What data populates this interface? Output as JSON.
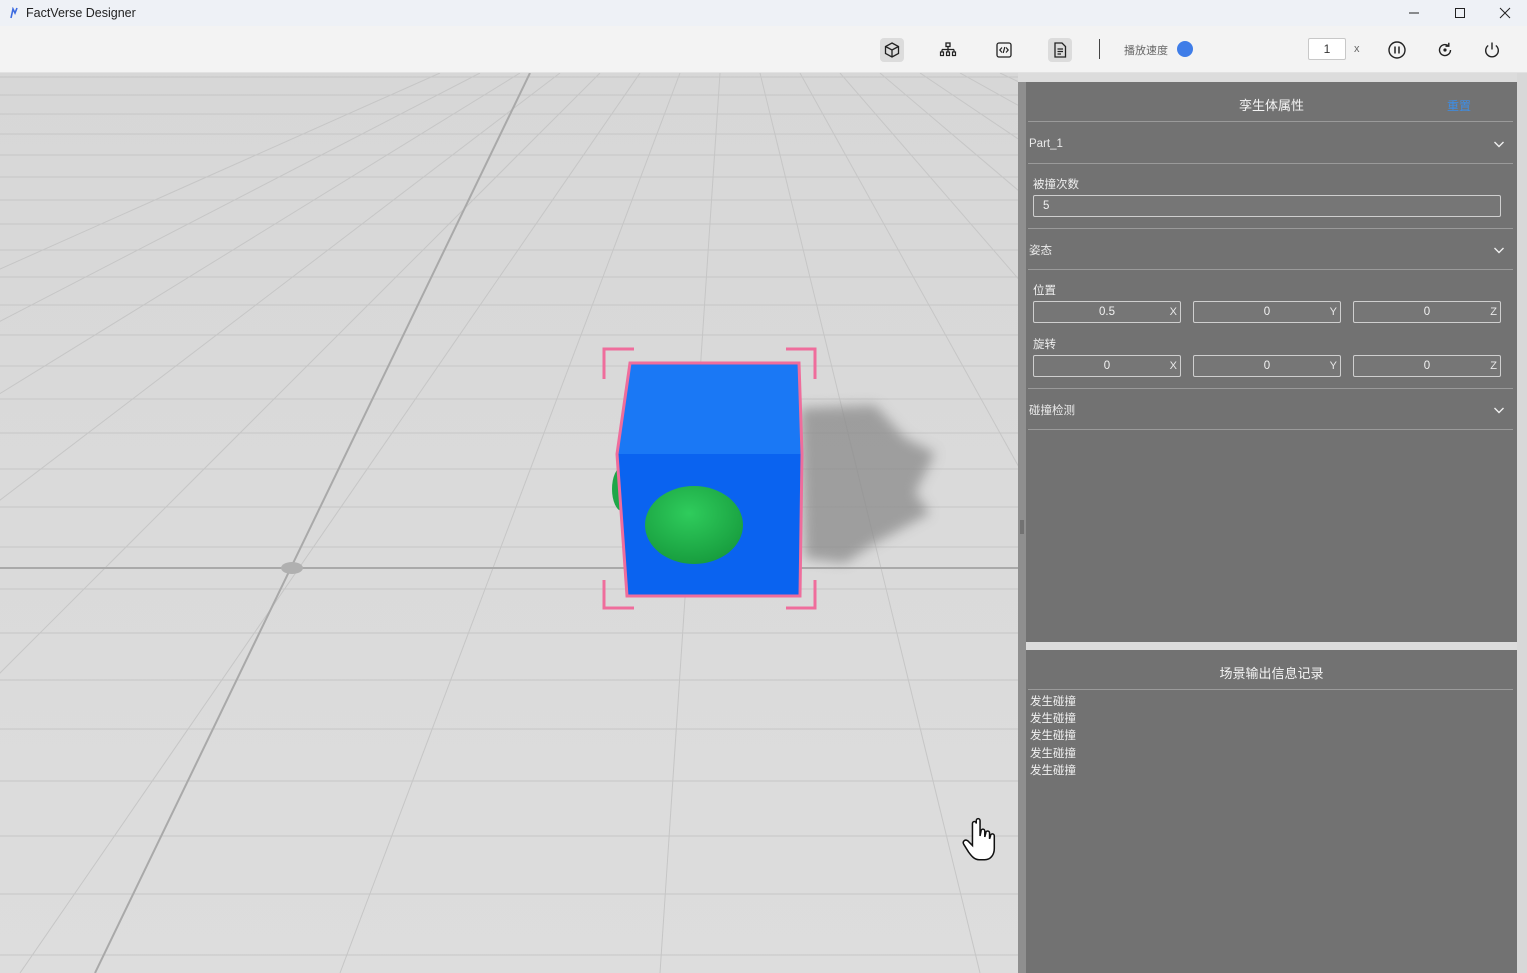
{
  "app": {
    "title": "FactVerse Designer"
  },
  "window_controls": {
    "minimize": "—",
    "maximize": "☐",
    "close": "✕"
  },
  "toolbar": {
    "buttons": [
      {
        "name": "model-view",
        "icon": "cube-icon",
        "active": true
      },
      {
        "name": "hierarchy",
        "icon": "hierarchy-icon",
        "active": false
      },
      {
        "name": "script",
        "icon": "code-icon",
        "active": false
      },
      {
        "name": "document",
        "icon": "document-icon",
        "active": true
      }
    ],
    "speed_label": "播放速度",
    "speed_value": "1",
    "speed_unit": "x",
    "accent": "#3f7de8"
  },
  "properties_panel": {
    "title": "孪生体属性",
    "reset_label": "重置",
    "part_section": {
      "label": "Part_1"
    },
    "hit_count": {
      "label": "被撞次数",
      "value": "5"
    },
    "pose_section": {
      "label": "姿态"
    },
    "position": {
      "label": "位置",
      "x": "0.5",
      "y": "0",
      "z": "0",
      "axes": [
        "X",
        "Y",
        "Z"
      ]
    },
    "rotation": {
      "label": "旋转",
      "x": "0",
      "y": "0",
      "z": "0",
      "axes": [
        "X",
        "Y",
        "Z"
      ]
    },
    "collision_section": {
      "label": "碰撞检测"
    }
  },
  "log_panel": {
    "title": "场景输出信息记录",
    "entries": [
      "发生碰撞",
      "发生碰撞",
      "发生碰撞",
      "发生碰撞",
      "发生碰撞"
    ]
  },
  "scene": {
    "cube_color": "#0a63f0",
    "sphere_color": "#22b04a",
    "selection_color": "#ef6d9c"
  }
}
